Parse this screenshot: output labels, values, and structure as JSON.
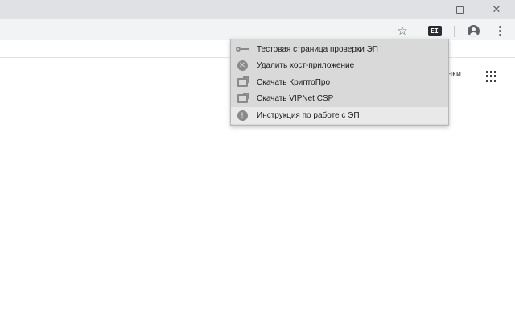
{
  "window": {
    "minimize_glyph": "",
    "maximize_glyph": "",
    "close_glyph": "✕"
  },
  "toolbar": {
    "bookmark_star_glyph": "☆",
    "extension_badge": "EI",
    "icons": [
      "star-icon",
      "extension-icon",
      "profile-icon",
      "menu-icon"
    ]
  },
  "page": {
    "partial_link": "нки",
    "apps_icon": "apps-grid-icon"
  },
  "extension_menu": {
    "items": [
      {
        "label": "Тестовая страница проверки ЭП",
        "icon": "key-icon"
      },
      {
        "label": "Удалить хост-приложение",
        "icon": "remove-circle-icon"
      },
      {
        "label": "Скачать КриптоПро",
        "icon": "external-link-icon"
      },
      {
        "label": "Скачать VIPNet CSP",
        "icon": "external-link-icon"
      },
      {
        "label": "Инструкция по работе с ЭП",
        "icon": "info-icon",
        "info_glyph": "!"
      }
    ],
    "remove_glyph": "✕"
  },
  "colors": {
    "titlebar": "#dfe1e5",
    "toolbar": "#f1f3f4",
    "menu_background": "#d9d9d9",
    "menu_highlight": "#e9e9e9"
  }
}
